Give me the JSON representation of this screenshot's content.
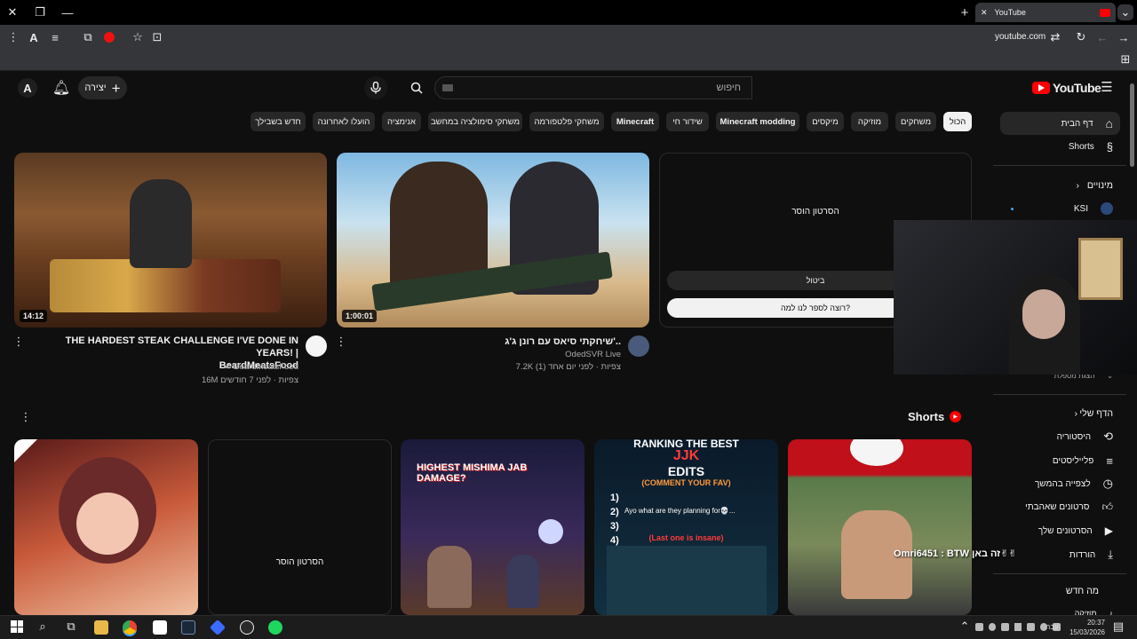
{
  "browser": {
    "tab_title": "YouTube",
    "url": "youtube.com"
  },
  "header": {
    "logo_text": "YouTube",
    "search_placeholder": "חיפוש",
    "create_label": "יצירה",
    "avatar_letter": "A"
  },
  "chips": [
    "הכול",
    "משחקים",
    "מוזיקה",
    "מיקסים",
    "Minecraft modding",
    "שידור חי",
    "Minecraft",
    "משחקי פלטפורמה",
    "משחקי סימולציה במחשב",
    "אנימציה",
    "הועלו לאחרונה",
    "חדש בשבילך"
  ],
  "sidebar": {
    "home": "דף הבית",
    "shorts": "Shorts",
    "subscriptions": "מינויים",
    "sub_ksi": "KSI",
    "sub_more": "הצגת מספלת",
    "you": "הדף שלי",
    "history": "היסטוריה",
    "playlists": "פלייליסטים",
    "watch_later": "לצפייה בהמשך",
    "liked": "סרטונים שאהבתי",
    "your_videos": "הסרטונים שלך",
    "downloads": "הורדות",
    "whats_new": "מה חדש",
    "music": "מוזיקה"
  },
  "videos": [
    {
      "title_line1": "THE HARDEST STEAK CHALLENGE I'VE DONE IN YEARS! |",
      "title_line2": "BeardMeatsFood",
      "channel": "BeardMeatsFood",
      "meta": "16M צפיות · לפני 7 חודשים",
      "duration": "14:12"
    },
    {
      "title": "שיחקתי סיאס עם רונן ג'ג'..",
      "channel": "OdedSVR Live",
      "meta": "7.2K צפיות · לפני יום אחד (1)",
      "duration": "1:00:01"
    },
    {
      "removed_text": "הסרטון הוסר",
      "undo_label": "ביטול",
      "tell_us_label": "רוצה לספר לנו למה?"
    }
  ],
  "shorts": {
    "section_title": "Shorts",
    "removed_text": "הסרטון הוסר",
    "short3_caption": "HIGHEST MISHIMA JAB DAMAGE?",
    "short4_line1": "RANKING THE BEST",
    "short4_line2": "JJK",
    "short4_line3": "EDITS",
    "short4_line4": "(COMMENT YOUR FAV)",
    "short4_sub": "Ayo what are they planning for💀...",
    "short4_footer": "(Last one is insane)",
    "short4_nums": [
      "1)",
      "2)",
      "3)",
      "4)"
    ]
  },
  "overlay_chat": "Omri6451 : BTW זה באן✌✌",
  "taskbar": {
    "lang": "עבר",
    "time": "20:37",
    "date": "15/03/2026"
  }
}
